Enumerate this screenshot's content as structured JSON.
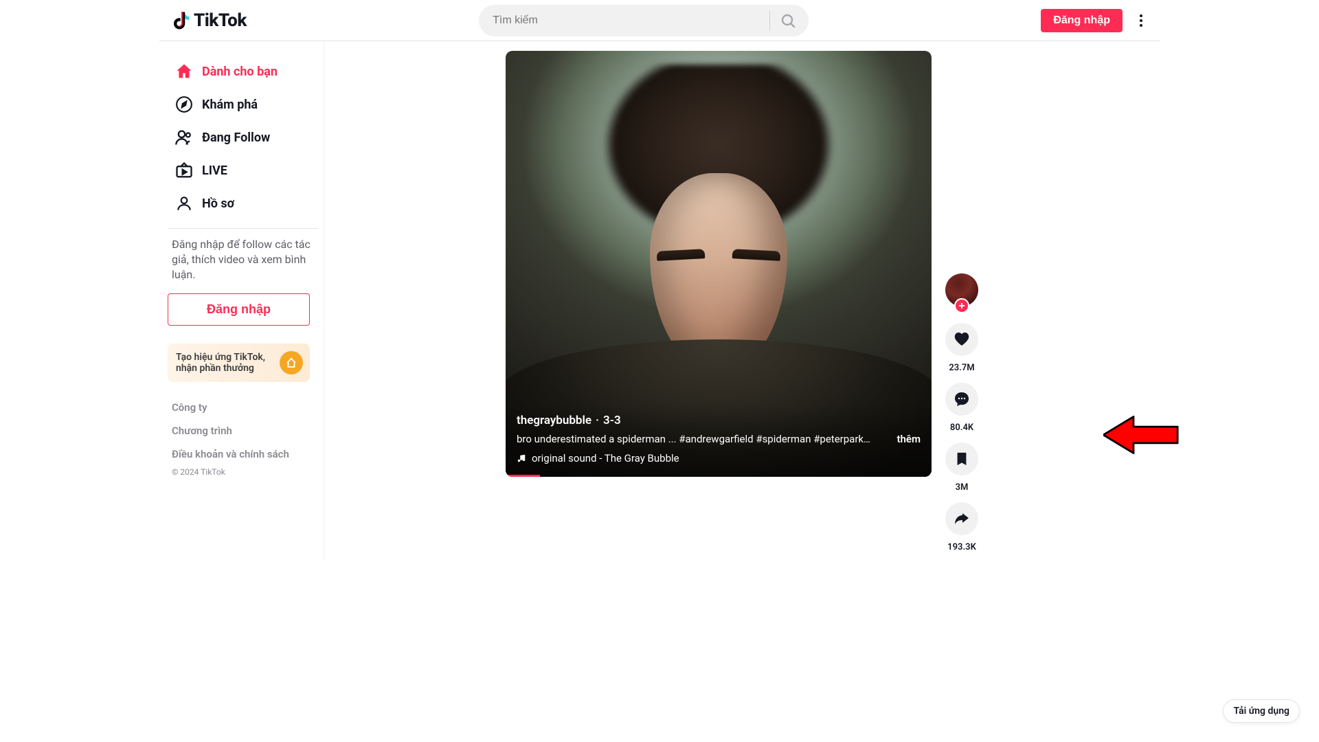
{
  "brand": "TikTok",
  "search": {
    "placeholder": "Tìm kiếm"
  },
  "header": {
    "login_label": "Đăng nhập"
  },
  "sidebar": {
    "for_you": "Dành cho bạn",
    "explore": "Khám phá",
    "following": "Đang Follow",
    "live": "LIVE",
    "profile": "Hồ sơ",
    "login_prompt": "Đăng nhập để follow các tác giả, thích video và xem bình luận.",
    "login_button": "Đăng nhập",
    "effect_card": "Tạo hiệu ứng TikTok, nhận phần thưởng"
  },
  "footer": {
    "company": "Công ty",
    "program": "Chương trình",
    "terms": "Điều khoản và chính sách",
    "copyright": "© 2024 TikTok"
  },
  "video": {
    "author": "thegraybubble",
    "date": "3-3",
    "caption_text": "bro underestimated a spiderman ...",
    "tags": "#andrewgarfield  #spiderman  #peterparker  ...",
    "more": "thêm",
    "sound": "original sound - The Gray Bubble"
  },
  "actions": {
    "likes": "23.7M",
    "comments": "80.4K",
    "saves": "3M",
    "shares": "193.3K"
  },
  "download_app": "Tải ứng dụng"
}
